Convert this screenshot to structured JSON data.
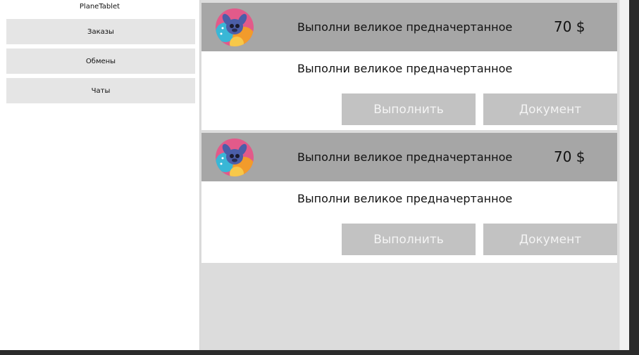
{
  "app": {
    "title": "PlaneTablet"
  },
  "sidebar": {
    "items": [
      {
        "label": "Заказы"
      },
      {
        "label": "Обмены"
      },
      {
        "label": "Чаты"
      }
    ]
  },
  "orders": [
    {
      "title": "Выполни великое предначертанное",
      "price": "70 $",
      "description": "Выполни великое предначертанное",
      "execute_label": "Выполнить",
      "document_label": "Документ"
    },
    {
      "title": "Выполни великое предначертанное",
      "price": "70 $",
      "description": "Выполни великое предначертанное",
      "execute_label": "Выполнить",
      "document_label": "Документ"
    }
  ],
  "colors": {
    "card_header": "#a6a6a6",
    "button_bg": "#c2c2c2",
    "main_bg": "#dcdcdc",
    "nav_bg": "#e5e5e5"
  },
  "icons": {
    "avatar": "stitch-avatar-icon"
  }
}
